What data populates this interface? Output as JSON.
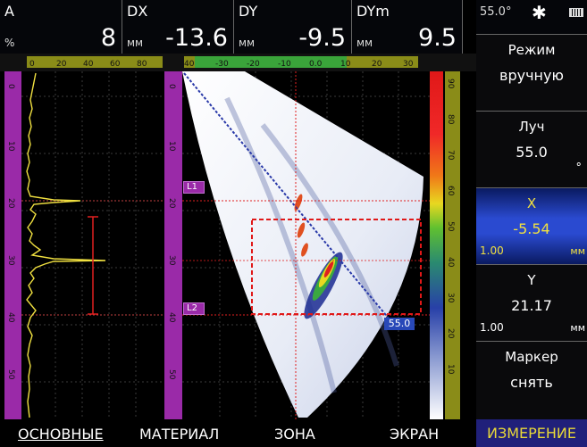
{
  "readouts": [
    {
      "label": "A",
      "unit": "%",
      "value": "8"
    },
    {
      "label": "DX",
      "unit": "мм",
      "value": "-13.6"
    },
    {
      "label": "DY",
      "unit": "мм",
      "value": "-9.5"
    },
    {
      "label": "DYm",
      "unit": "мм",
      "value": "9.5"
    }
  ],
  "status": {
    "angle": "55.0°",
    "star": "✱"
  },
  "ascan_ruler_ticks": [
    "0",
    "20",
    "40",
    "60",
    "80"
  ],
  "sector_ruler_ticks": [
    "40",
    "-30",
    "-20",
    "-10",
    "0.0",
    "10",
    "20",
    "30"
  ],
  "left_depth_ticks": [
    "0",
    "10",
    "20",
    "30",
    "40",
    "50"
  ],
  "palette_ticks": [
    "90",
    "80",
    "70",
    "60",
    "50",
    "40",
    "30",
    "20",
    "10"
  ],
  "gate_labels": {
    "l1": "L1",
    "l2": "L2"
  },
  "beam_tag": "55.0",
  "menu": {
    "mode": {
      "caption": "Режим",
      "value": "вручную"
    },
    "beam": {
      "caption": "Луч",
      "value": "55.0",
      "unit": "°"
    },
    "x": {
      "caption": "X",
      "value": "-5.54",
      "step": "1.00",
      "unit": "мм"
    },
    "y": {
      "caption": "Y",
      "value": "21.17",
      "step": "1.00",
      "unit": "мм"
    },
    "marker": {
      "caption": "Маркер",
      "value": "снять"
    }
  },
  "tabs": [
    "ОСНОВНЫЕ",
    "МАТЕРИАЛ",
    "ЗОНА",
    "ЭКРАН",
    "ИЗМЕРЕНИЕ"
  ],
  "colors": {
    "accent_blue": "#1e3ea8",
    "active_tab": "#e8d838",
    "ruler": "#8a8c18",
    "gate": "#9a2aa8"
  }
}
